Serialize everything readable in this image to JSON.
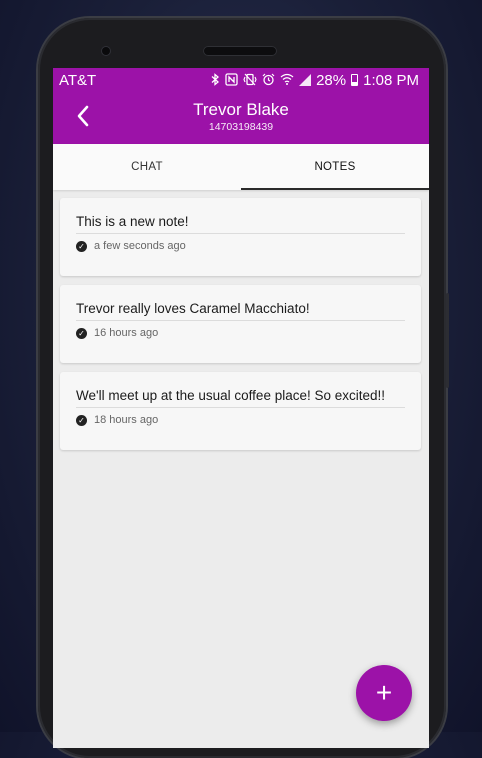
{
  "status_bar": {
    "carrier": "AT&T",
    "battery_percent": "28%",
    "time": "1:08 PM",
    "icons": [
      "bluetooth-icon",
      "nfc-icon",
      "vibrate-icon",
      "alarm-icon",
      "wifi-icon",
      "signal-icon",
      "battery-icon"
    ]
  },
  "header": {
    "back_icon": "chevron-left-icon",
    "contact_name": "Trevor Blake",
    "contact_phone": "14703198439"
  },
  "tabs": [
    {
      "label": "CHAT",
      "active": false
    },
    {
      "label": "NOTES",
      "active": true
    }
  ],
  "notes": [
    {
      "text": "This is a new note!",
      "time": "a few seconds ago"
    },
    {
      "text": "Trevor really loves Caramel Macchiato!",
      "time": "16 hours ago"
    },
    {
      "text": "We'll meet up at the usual coffee place! So excited!!",
      "time": "18 hours ago"
    }
  ],
  "fab": {
    "label": "+",
    "icon": "plus-icon"
  },
  "colors": {
    "accent": "#9c12a8",
    "background": "#ececec",
    "card": "#f7f7f7"
  }
}
